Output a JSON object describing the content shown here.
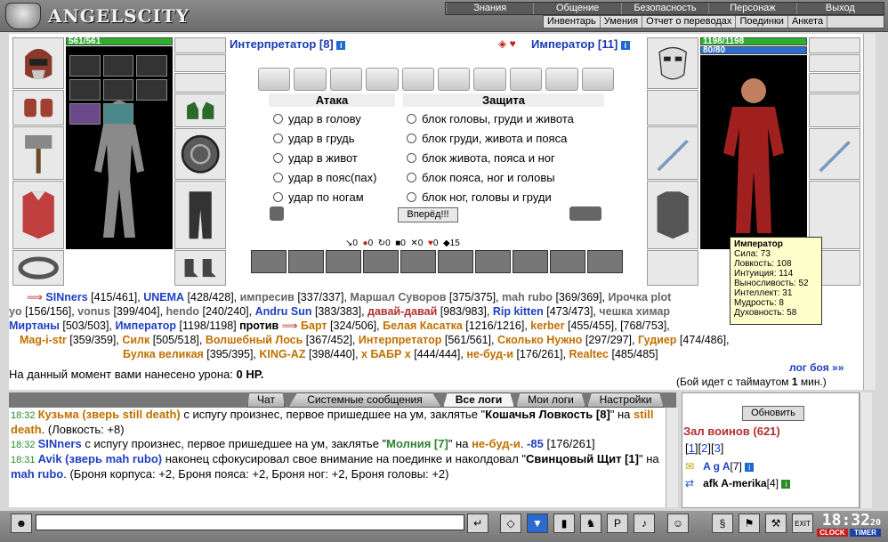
{
  "logo": {
    "title": "ANGELSCITY"
  },
  "menu_top": [
    "Знания",
    "Общение",
    "Безопасность",
    "Персонаж",
    "Выход"
  ],
  "menu_sub": [
    "Инвентарь",
    "Умения",
    "Отчет о переводах",
    "Поединки",
    "Анкета"
  ],
  "left_fighter": {
    "name": "Интерпретатор [8]",
    "hp": "561/561"
  },
  "right_fighter": {
    "name": "Император [11]",
    "hp": "1198/1198",
    "mp": "80/80"
  },
  "attack": {
    "title": "Атака",
    "options": [
      "удар в голову",
      "удар в грудь",
      "удар в живот",
      "удар в пояс(пах)",
      "удар по ногам"
    ]
  },
  "defense": {
    "title": "Защита",
    "options": [
      "блок головы, груди и живота",
      "блок груди, живота и пояса",
      "блок живота, пояса и ног",
      "блок пояса, ног и головы",
      "блок ног, головы и груди"
    ]
  },
  "forward_button": "Вперёд!!!",
  "stats_row": [
    "0",
    "0",
    "0",
    "0",
    "0",
    "0",
    "15"
  ],
  "tooltip": {
    "name": "Император",
    "lines": [
      "Сила: 73",
      "Ловкость: 108",
      "Интуиция: 114",
      "Выносливость: 52",
      "Интеллект: 31",
      "Мудрость: 8",
      "Духовность: 58"
    ]
  },
  "players": {
    "line1": [
      {
        "n": "SINners",
        "v": " [415/461], ",
        "c": "blue"
      },
      {
        "n": "UNEMA",
        "v": " [428/428], ",
        "c": "blue"
      },
      {
        "n": "импресив",
        "v": " [337/337], ",
        "c": "gray"
      },
      {
        "n": "Маршал Суворов",
        "v": " [375/375], ",
        "c": "gray"
      },
      {
        "n": "mah rubo",
        "v": " [369/369], ",
        "c": "gray"
      },
      {
        "n": "Ирочка",
        "v": "",
        "c": "gray"
      }
    ],
    "line1_tail": "plot",
    "line2": [
      {
        "n": "yo",
        "v": " [156/156], ",
        "c": "gray"
      },
      {
        "n": "vonus",
        "v": " [399/404], ",
        "c": "gray"
      },
      {
        "n": "hendo",
        "v": " [240/240], ",
        "c": "gray"
      },
      {
        "n": "Andru Sun",
        "v": " [383/383], ",
        "c": "blue"
      },
      {
        "n": "давай-давай",
        "v": " [983/983], ",
        "c": "red"
      },
      {
        "n": "Rip kitten",
        "v": " [473/473], ",
        "c": "blue"
      },
      {
        "n": "чешка",
        "v": "",
        "c": "gray"
      }
    ],
    "line2_tail": "химар",
    "line3": [
      {
        "n": "Миртаны",
        "v": " [503/503], ",
        "c": "blue"
      },
      {
        "n": "Император",
        "v": " [1198/1198] ",
        "c": "blue"
      }
    ],
    "versus": "против",
    "line3b": [
      {
        "n": "Барт",
        "v": " [324/506], ",
        "c": "orange"
      },
      {
        "n": "Белая Касатка",
        "v": " [1216/1216], ",
        "c": "orange"
      },
      {
        "n": "kerber",
        "v": " [455/455], ",
        "c": "orange"
      }
    ],
    "line3_tail": "[768/753],",
    "line4": [
      {
        "n": "Mag-i-str",
        "v": " [359/359], ",
        "c": "orange"
      },
      {
        "n": "Силк",
        "v": " [505/518], ",
        "c": "orange"
      },
      {
        "n": "Волшебный Лось",
        "v": " [367/452], ",
        "c": "orange"
      },
      {
        "n": "Интерпретатор",
        "v": " [561/561], ",
        "c": "orange"
      },
      {
        "n": "Сколько Нужно",
        "v": " [297/297], ",
        "c": "orange"
      },
      {
        "n": "Гудиер",
        "v": " [474/486],",
        "c": "orange"
      }
    ],
    "line5": [
      {
        "n": "Булка великая",
        "v": " [395/395], ",
        "c": "orange"
      },
      {
        "n": "KING-AZ",
        "v": " [398/440], ",
        "c": "orange"
      },
      {
        "n": "х БАБР х",
        "v": " [444/444], ",
        "c": "orange"
      },
      {
        "n": "не-буд-и",
        "v": " [176/261], ",
        "c": "orange"
      },
      {
        "n": "Realtec",
        "v": " [485/485]",
        "c": "orange"
      }
    ]
  },
  "damage_text": "На данный момент вами нанесено урона: ",
  "damage_value": "0 HP.",
  "log_link": "лог боя »»",
  "timeout": {
    "pre": "(Бой идет с таймаутом ",
    "val": "1",
    "post": " мин.)"
  },
  "tabs": [
    "Чат",
    "Системные сообщения",
    "Все логи",
    "Мои логи",
    "Настройки"
  ],
  "active_tab": "Все логи",
  "chat": [
    {
      "time": "18:32",
      "parts": [
        [
          "nm orange",
          "Кузьма (зверь still death)"
        ],
        [
          "",
          "  с испугу произнес, первое пришедшее на ум, заклятье \""
        ],
        [
          "nm",
          "Кошачья Ловкость [8]"
        ],
        [
          "",
          "\" на "
        ],
        [
          "nm orange",
          "still death"
        ],
        [
          "",
          ". (Ловкость: +8)"
        ]
      ]
    },
    {
      "time": "18:32",
      "parts": [
        [
          "nm blue",
          "SINners"
        ],
        [
          "",
          "  с испугу произнес, первое пришедшее на ум, заклятье \""
        ],
        [
          "nm green",
          "Молния [7]"
        ],
        [
          "",
          "\" на "
        ],
        [
          "nm orange",
          "не-буд-и"
        ],
        [
          "",
          ". "
        ],
        [
          "nm blue",
          "-85"
        ],
        [
          "",
          "  [176/261]"
        ]
      ]
    },
    {
      "time": "18:31",
      "parts": [
        [
          "nm blue",
          "Avik (зверь mah rubo)"
        ],
        [
          "",
          "  наконец сфокусировал свое внимание на поединке и наколдовал \""
        ],
        [
          "nm",
          "Свинцовый Щит [1]"
        ],
        [
          "",
          "\" на "
        ],
        [
          "nm blue",
          "mah rubo"
        ],
        [
          "",
          ". (Броня корпуса: +2, Броня пояса: +2, Броня ног: +2, Броня головы: +2)"
        ]
      ]
    }
  ],
  "right_panel": {
    "refresh": "Обновить",
    "hall_title": "Зал воинов (621)",
    "pages": [
      "1",
      "2",
      "3"
    ],
    "users": [
      {
        "name": "A g A",
        "level": "[7]"
      },
      {
        "name": "afk A-merika",
        "level": "[4]"
      }
    ]
  },
  "clock": {
    "time": "18:32",
    "sec": "20",
    "label_clock": "CLOCK",
    "label_timer": "TIMER"
  }
}
